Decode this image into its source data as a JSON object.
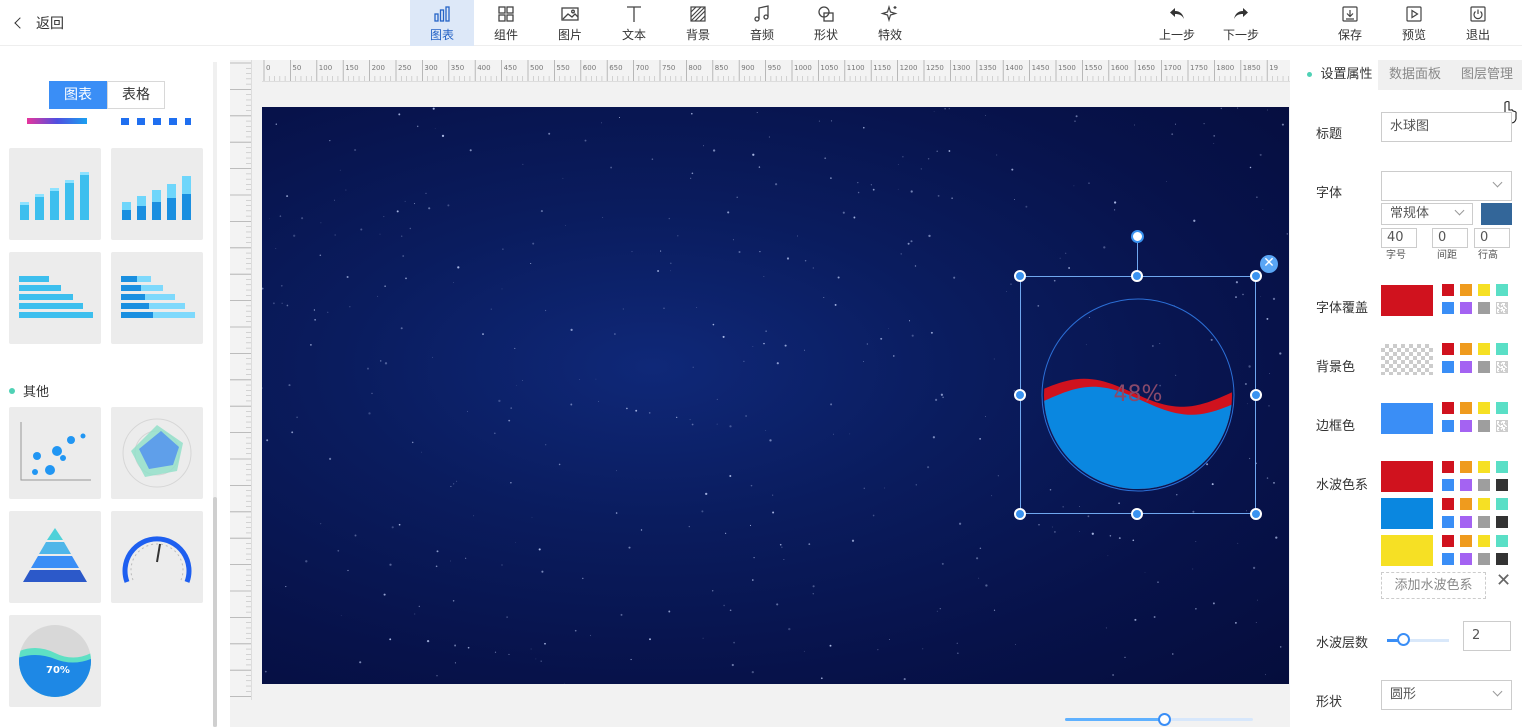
{
  "header": {
    "back_label": "返回",
    "tools": [
      {
        "label": "图表",
        "icon": "chart-icon",
        "active": true
      },
      {
        "label": "组件",
        "icon": "grid-icon"
      },
      {
        "label": "图片",
        "icon": "image-icon"
      },
      {
        "label": "文本",
        "icon": "text-icon"
      },
      {
        "label": "背景",
        "icon": "background-icon"
      },
      {
        "label": "音频",
        "icon": "music-icon"
      },
      {
        "label": "形状",
        "icon": "shape-icon"
      },
      {
        "label": "特效",
        "icon": "sparkle-icon"
      }
    ],
    "undo_label": "上一步",
    "redo_label": "下一步",
    "save_label": "保存",
    "preview_label": "预览",
    "exit_label": "退出"
  },
  "left_panel": {
    "tabs": [
      "图表",
      "表格"
    ],
    "active_tab": "图表",
    "section_other": "其他",
    "gauge_value_label": "70%"
  },
  "ruler": {
    "top_ticks": [
      "0",
      "50",
      "100",
      "150",
      "200",
      "250",
      "300",
      "350",
      "400",
      "450",
      "500",
      "550",
      "600",
      "650",
      "700",
      "750",
      "800",
      "850",
      "900",
      "950",
      "1000",
      "1050",
      "1100",
      "1150",
      "1200",
      "1250",
      "1300",
      "1350",
      "1400",
      "1450",
      "1500",
      "1550",
      "1600",
      "1650",
      "1700",
      "1750",
      "1800",
      "1850",
      "19"
    ]
  },
  "canvas": {
    "widget": {
      "type": "liquid-fill",
      "percent_label": "48%",
      "value": 0.48
    }
  },
  "zoom": {
    "value": 0.53
  },
  "right_panel": {
    "tabs": [
      "设置属性",
      "数据面板",
      "图层管理"
    ],
    "active_tab": "设置属性",
    "title_label": "标题",
    "title_value": "水球图",
    "font_label": "字体",
    "font_family_value": "",
    "font_style_value": "常规体",
    "font_color": "#336699",
    "font_size_value": "40",
    "spacing_value": "0",
    "line_height_value": "0",
    "font_size_caption": "字号",
    "spacing_caption": "间距",
    "line_height_caption": "行高",
    "font_cover_label": "字体覆盖",
    "font_cover_color": "#d0121e",
    "bg_color_label": "背景色",
    "border_color_label": "边框色",
    "border_color": "#3a8ef6",
    "wave_colors_label": "水波色系",
    "wave_colors": [
      "#d0121e",
      "#0a87e0",
      "#f6e024"
    ],
    "add_wave_label": "添加水波色系",
    "wave_layers_label": "水波层数",
    "wave_layers_value": "2",
    "shape_label": "形状",
    "shape_value": "圆形",
    "palette": [
      "#d0121e",
      "#ef9b1e",
      "#f6e024",
      "#5adfc6",
      "#3a8ef6",
      "#a463f2",
      "#9e9e9e",
      "checker"
    ],
    "palette_dark": [
      "#d0121e",
      "#ef9b1e",
      "#f6e024",
      "#5adfc6",
      "#3a8ef6",
      "#a463f2",
      "#9e9e9e",
      "#333333"
    ]
  }
}
